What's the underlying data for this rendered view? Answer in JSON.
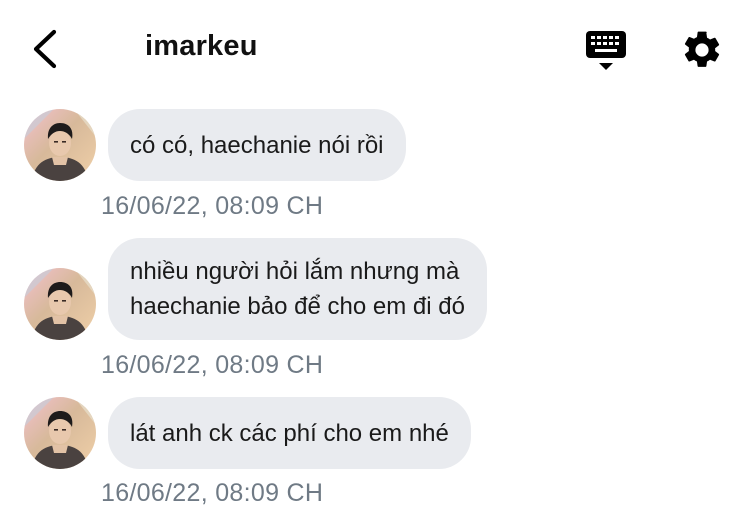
{
  "header": {
    "back_icon": "chevron-left-icon",
    "title": "imarkeu",
    "keyboard_icon": "keyboard-icon",
    "settings_icon": "gear-icon"
  },
  "colors": {
    "bubble_bg": "#e9ebef",
    "timestamp": "#6f7a85",
    "text": "#111111"
  },
  "messages": [
    {
      "text": "có có, haechanie nói rồi",
      "time": "16/06/22, 08:09 CH"
    },
    {
      "text": "nhiều người hỏi lắm nhưng mà\nhaechanie bảo để cho em đi đó",
      "time": "16/06/22, 08:09 CH"
    },
    {
      "text": "lát anh ck các phí cho em nhé",
      "time": "16/06/22, 08:09 CH"
    }
  ]
}
